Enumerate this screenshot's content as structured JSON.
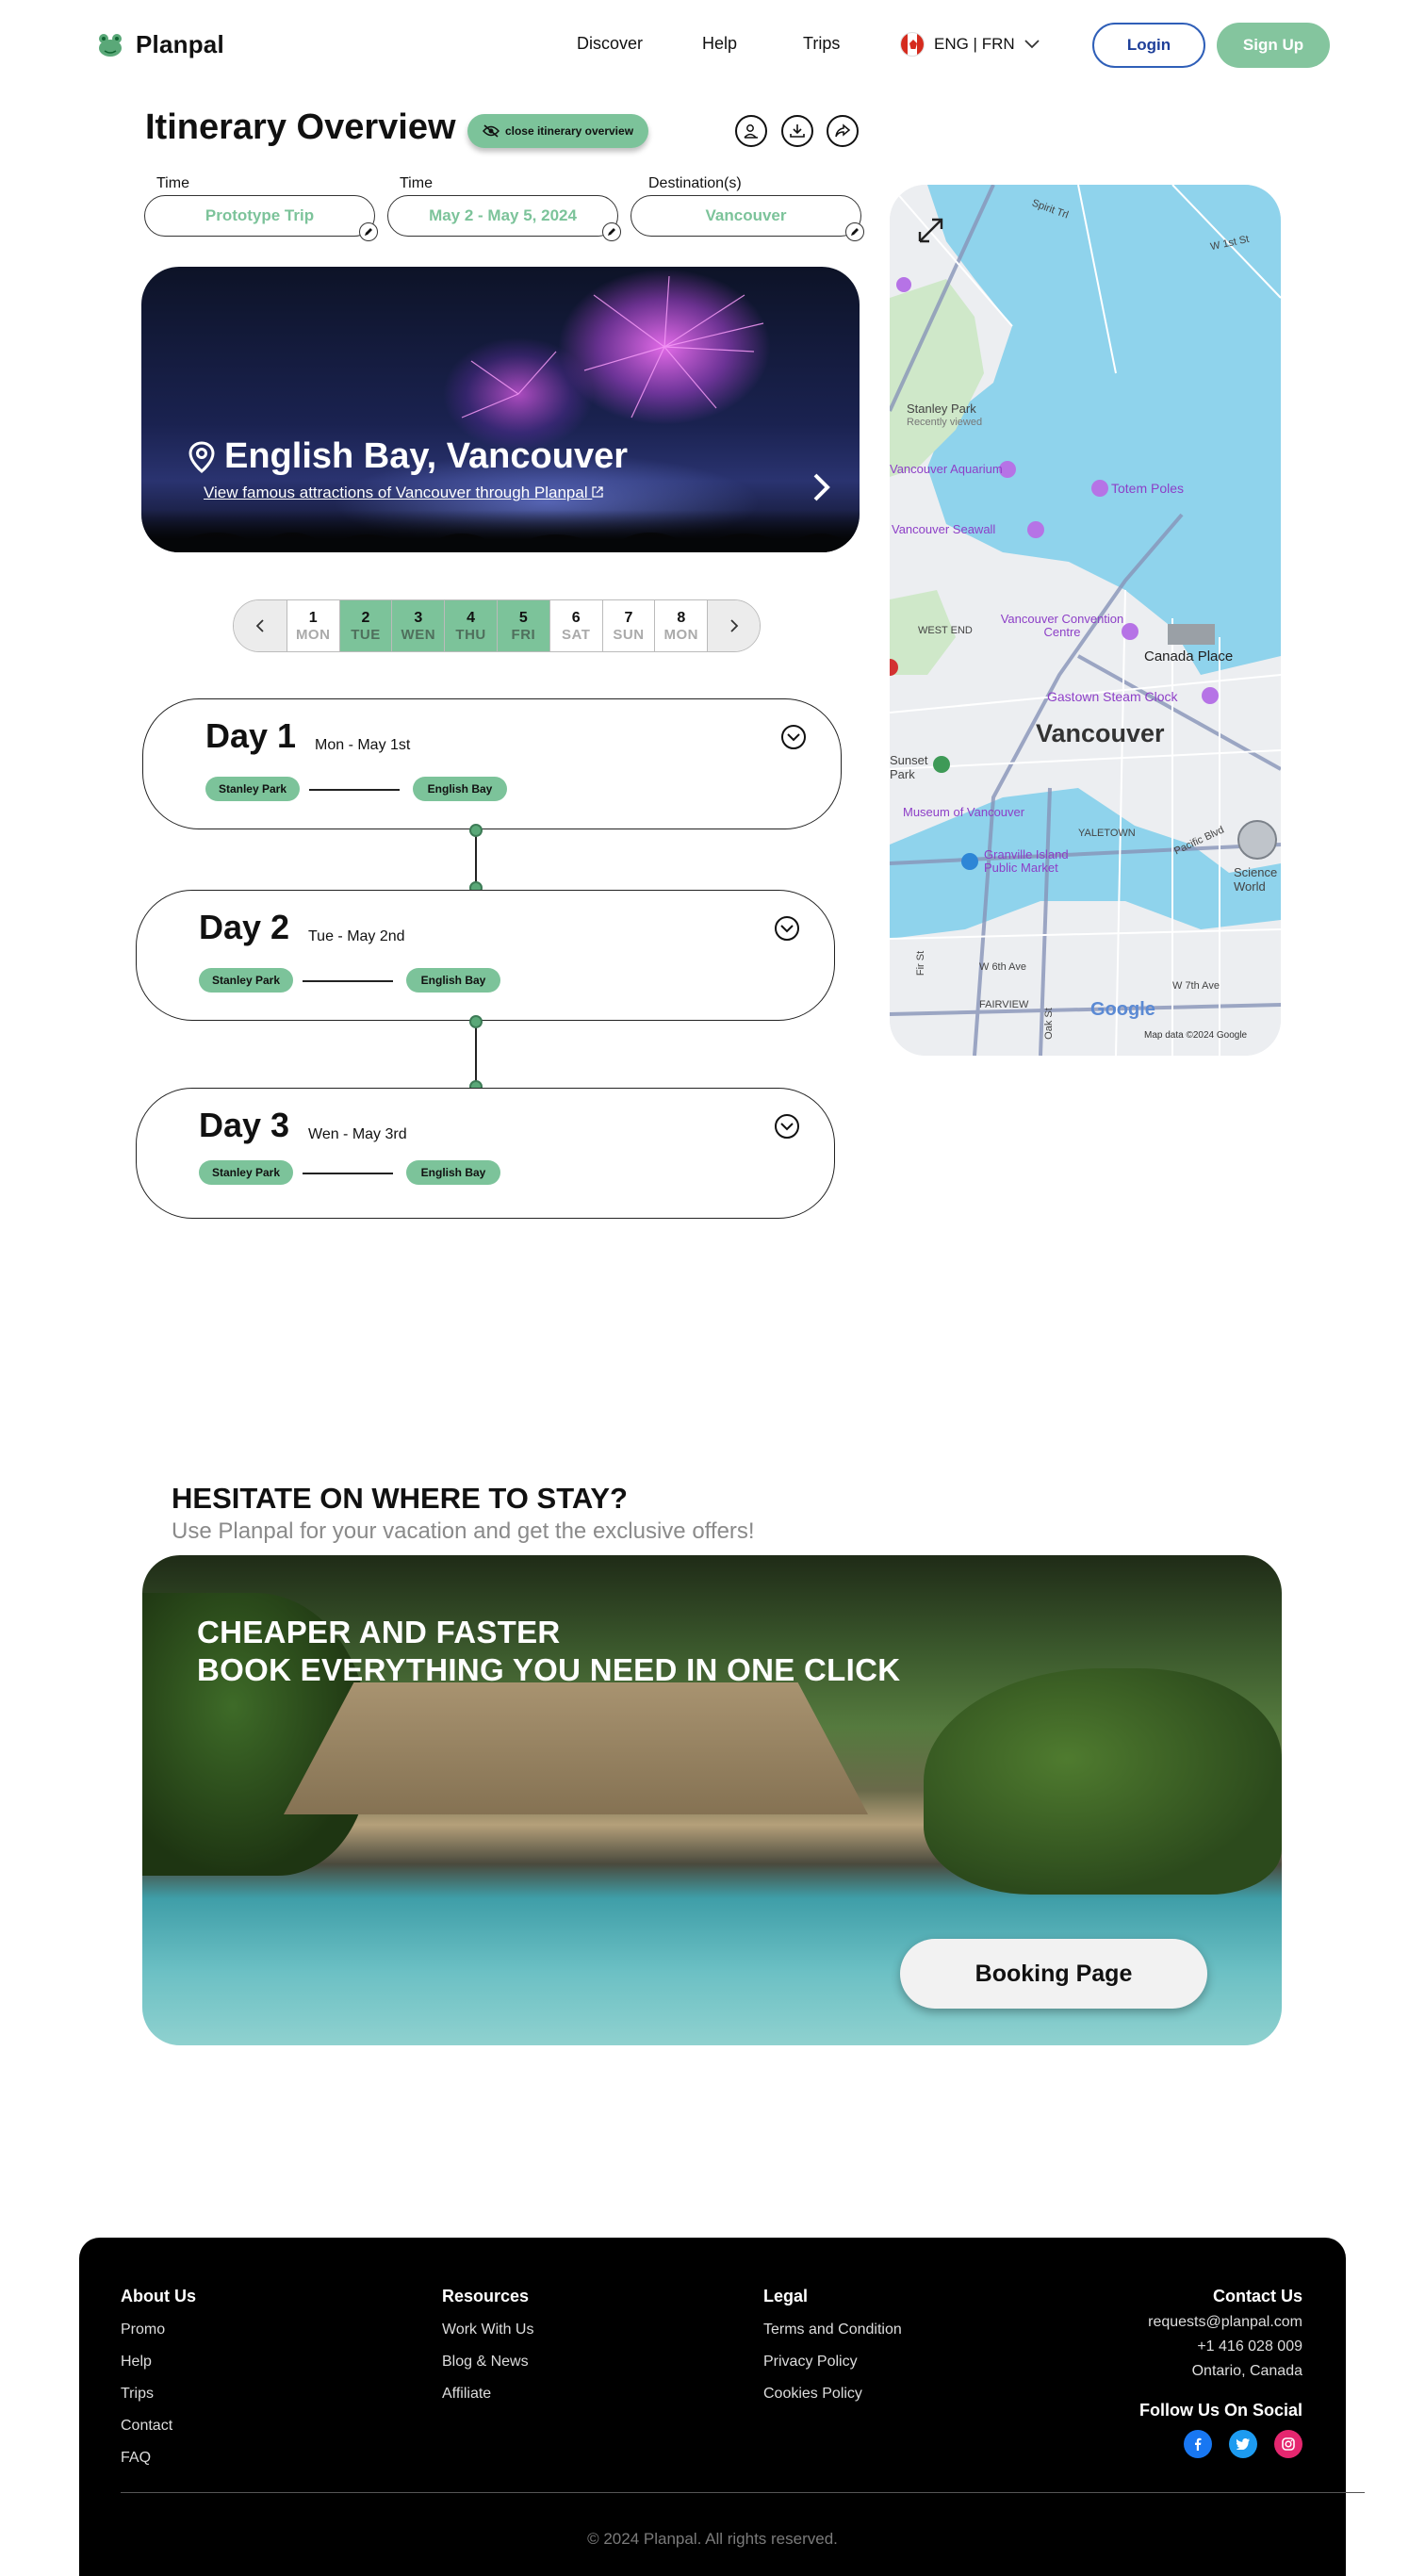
{
  "header": {
    "logo": "Planpal",
    "nav": [
      "Discover",
      "Help",
      "Trips"
    ],
    "language": "ENG | FRN",
    "login": "Login",
    "signup": "Sign Up"
  },
  "itinerary": {
    "title": "Itinerary Overview",
    "close_label": "close itinerary overview",
    "fields": [
      {
        "label": "Time",
        "value": "Prototype Trip"
      },
      {
        "label": "Time",
        "value": "May 2 - May 5, 2024"
      },
      {
        "label": "Destination(s)",
        "value": "Vancouver"
      }
    ],
    "hero": {
      "title": "English Bay, Vancouver",
      "subtitle": "View famous attractions of Vancouver through Planpal"
    },
    "day_strip": [
      {
        "num": "1",
        "dow": "MON",
        "active": false
      },
      {
        "num": "2",
        "dow": "TUE",
        "active": true
      },
      {
        "num": "3",
        "dow": "WEN",
        "active": true
      },
      {
        "num": "4",
        "dow": "THU",
        "active": true
      },
      {
        "num": "5",
        "dow": "FRI",
        "active": true
      },
      {
        "num": "6",
        "dow": "SAT",
        "active": false
      },
      {
        "num": "7",
        "dow": "SUN",
        "active": false
      },
      {
        "num": "8",
        "dow": "MON",
        "active": false
      }
    ],
    "days": [
      {
        "title": "Day 1",
        "date": "Mon - May 1st",
        "from": "Stanley Park",
        "to": "English Bay"
      },
      {
        "title": "Day 2",
        "date": "Tue - May 2nd",
        "from": "Stanley Park",
        "to": "English Bay"
      },
      {
        "title": "Day 3",
        "date": "Wen - May 3rd",
        "from": "Stanley Park",
        "to": "English Bay"
      }
    ]
  },
  "map": {
    "city": "Vancouver",
    "labels": [
      "Stanley Park",
      "Recently viewed",
      "Vancouver Aquarium",
      "Totem Poles",
      "Vancouver Seawall",
      "WEST END",
      "Vancouver Convention Centre",
      "Canada Place",
      "Gastown Steam Clock",
      "Sunset Park",
      "Museum of Vancouver",
      "YALETOWN",
      "Granville Island Public Market",
      "Science World",
      "W 6th Ave",
      "W 7th Ave",
      "FAIRVIEW",
      "Pacific Blvd",
      "Spirit Trl",
      "W 1st St",
      "Oak St",
      "Fir St"
    ],
    "attribution": "Map data ©2024 Google",
    "brand": "Google",
    "colors": {
      "water": "#8fd3ec",
      "land": "#eceef1",
      "park": "#cfe8c9"
    }
  },
  "stay": {
    "title": "HESITATE ON WHERE TO STAY?",
    "subtitle": "Use Planpal for your vacation and get the exclusive offers!",
    "headline1": "CHEAPER AND FASTER",
    "headline2": "BOOK EVERYTHING YOU NEED IN ONE CLICK",
    "button": "Booking Page"
  },
  "footer": {
    "about": {
      "title": "About Us",
      "links": [
        "Promo",
        "Help",
        "Trips",
        "Contact",
        "FAQ"
      ]
    },
    "resources": {
      "title": "Resources",
      "links": [
        "Work With Us",
        "Blog & News",
        "Affiliate"
      ]
    },
    "legal": {
      "title": "Legal",
      "links": [
        "Terms and Condition",
        "Privacy Policy",
        "Cookies Policy"
      ]
    },
    "contact": {
      "title": "Contact Us",
      "email": "requests@planpal.com",
      "phone": "+1 416 028 009",
      "location": "Ontario, Canada"
    },
    "social_title": "Follow Us On Social",
    "copyright": "© 2024 Planpal. All rights reserved."
  },
  "colors": {
    "accent": "#7cc39a",
    "login_border": "#2f5fb8",
    "footer_bg": "#000000"
  }
}
